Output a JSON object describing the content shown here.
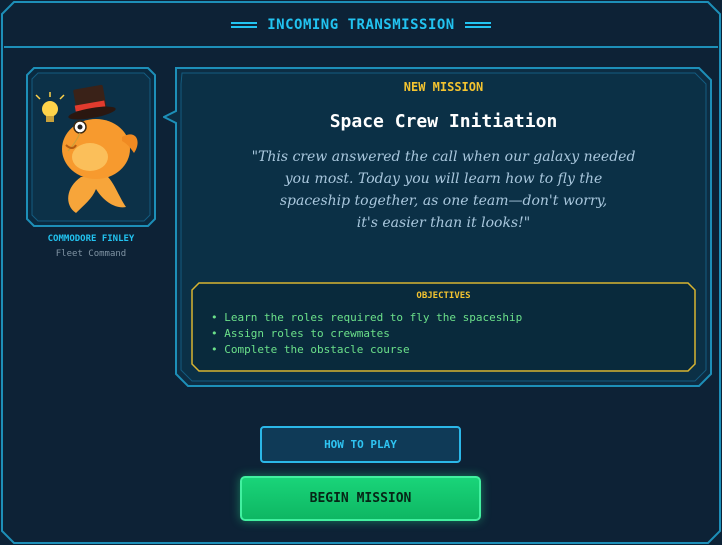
{
  "header": {
    "title": "INCOMING TRANSMISSION"
  },
  "character": {
    "name": "COMMODORE FINLEY",
    "role": "Fleet Command"
  },
  "mission": {
    "tag": "NEW MISSION",
    "title": "Space Crew Initiation",
    "quote_lines": [
      "\"This crew answered the call when our galaxy needed",
      "you most. Today you will learn how to fly the",
      "spaceship together, as one team—don't worry,",
      "it's easier than it looks!\""
    ]
  },
  "objectives": {
    "title": "OBJECTIVES",
    "items": [
      "Learn the roles required to fly the spaceship",
      "Assign roles to crewmates",
      "Complete the obstacle course"
    ]
  },
  "buttons": {
    "how_to_play": "HOW TO PLAY",
    "begin_mission": "BEGIN MISSION"
  },
  "colors": {
    "accent_cyan": "#22c3f0",
    "gold": "#f4c430",
    "objective_green": "#6be08a",
    "begin_green": "#19d479",
    "background": "#0d2236"
  },
  "icons": [
    "goldfish-captain-portrait",
    "lightbulb-icon",
    "top-hat-icon",
    "monocle-icon"
  ]
}
